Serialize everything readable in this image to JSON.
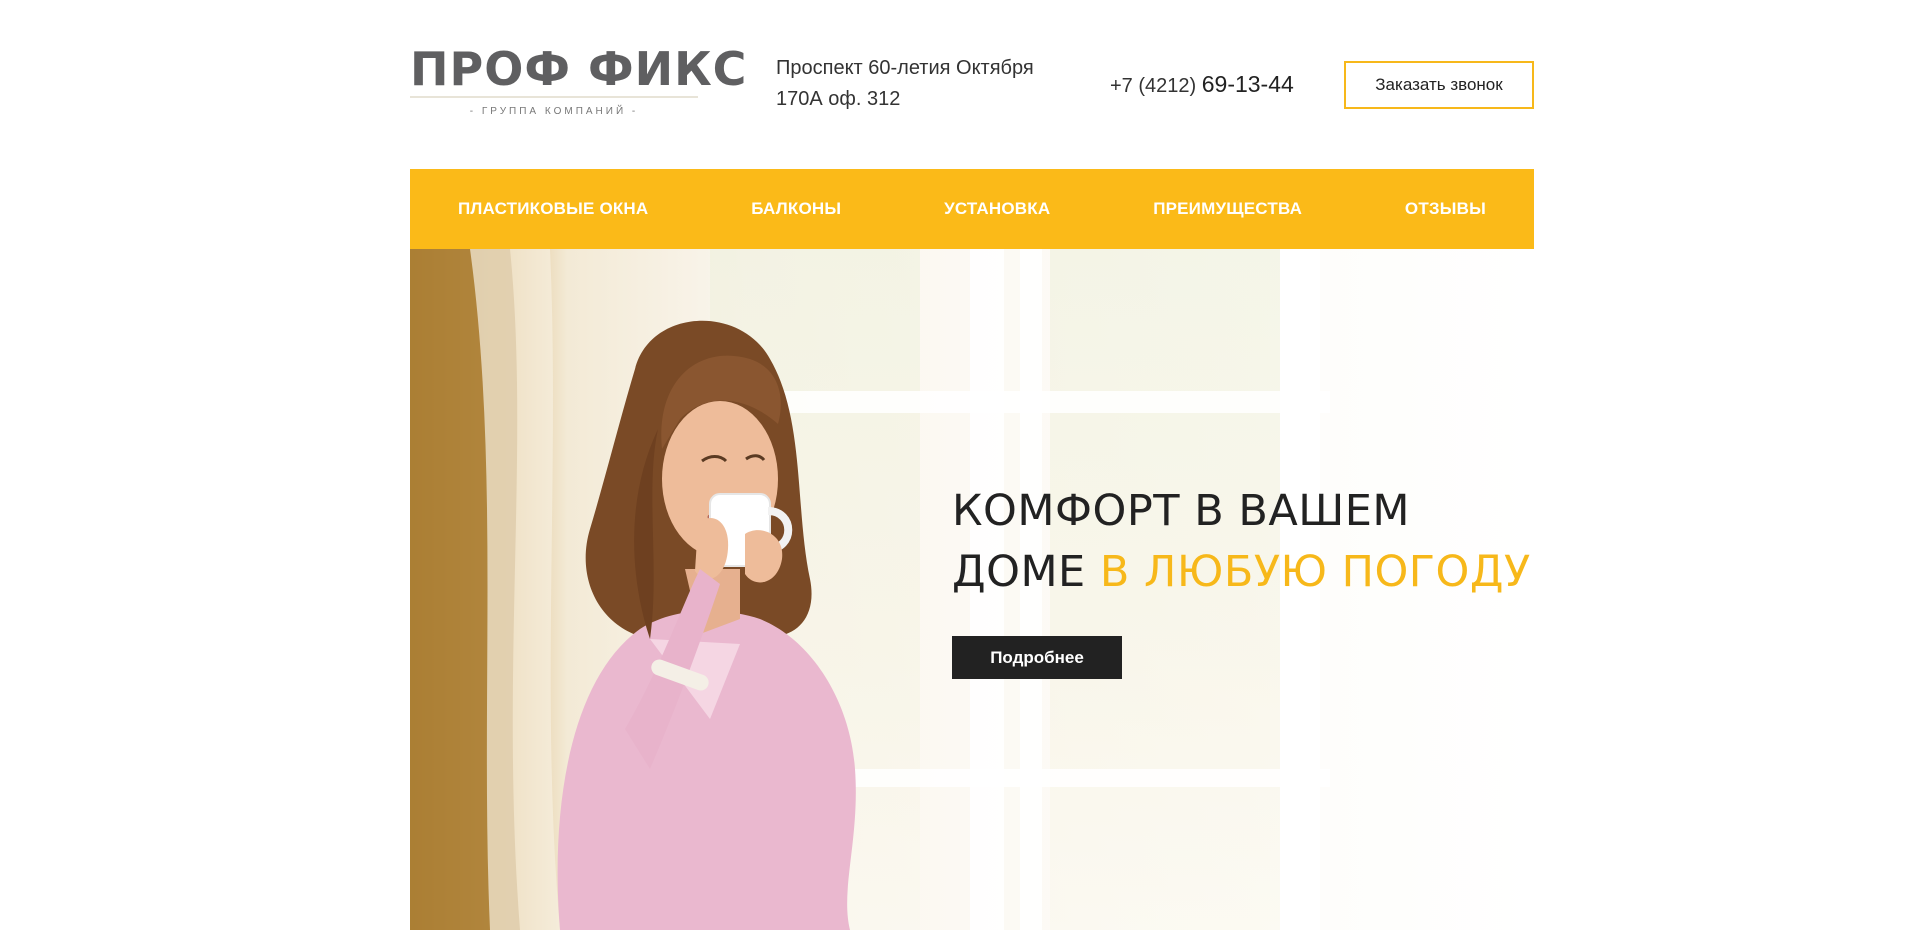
{
  "logo": {
    "name": "ПРОФ ФИКС",
    "subtitle": "- ГРУППА КОМПАНИЙ -"
  },
  "header": {
    "address_line1": "Проспект 60-летия Октября",
    "address_line2": "170А оф. 312",
    "phone_prefix": "+7 (4212) ",
    "phone_number": "69-13-44",
    "callback_label": "Заказать звонок"
  },
  "nav": {
    "items": [
      {
        "label": "ПЛАСТИКОВЫЕ ОКНА"
      },
      {
        "label": "БАЛКОНЫ"
      },
      {
        "label": "УСТАНОВКА"
      },
      {
        "label": "ПРЕИМУЩЕСТВА"
      },
      {
        "label": "ОТЗЫВЫ"
      }
    ]
  },
  "hero": {
    "title_line1": "КОМФОРТ В ВАШЕМ",
    "title_line2_plain": "ДОМЕ ",
    "title_line2_accent": "В ЛЮБУЮ ПОГОДУ!",
    "button_label": "Подробнее"
  },
  "colors": {
    "accent": "#fbba18",
    "dark": "#222222"
  }
}
